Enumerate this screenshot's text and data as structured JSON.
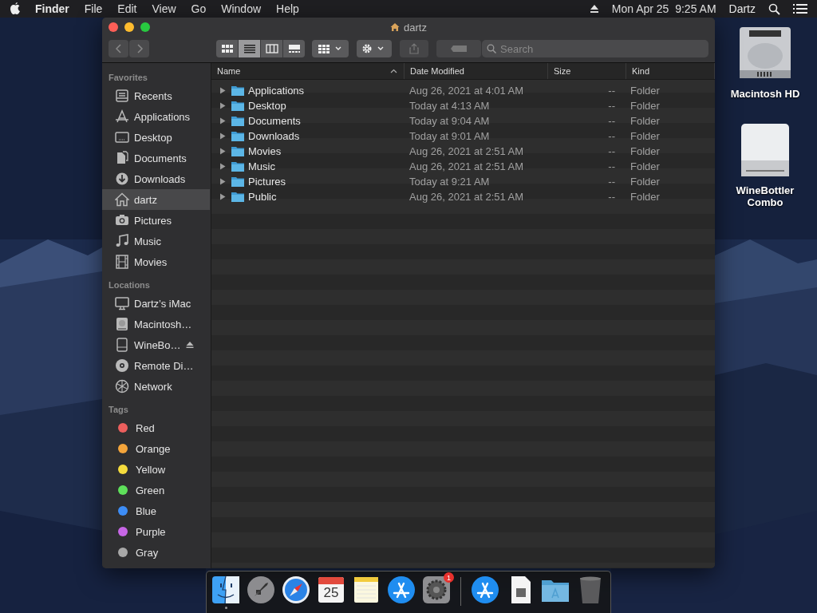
{
  "menu_bar": {
    "items": [
      {
        "label": "Finder",
        "kind": "app"
      },
      {
        "label": "File",
        "kind": "menu"
      },
      {
        "label": "Edit",
        "kind": "menu"
      },
      {
        "label": "View",
        "kind": "menu"
      },
      {
        "label": "Go",
        "kind": "menu"
      },
      {
        "label": "Window",
        "kind": "menu"
      },
      {
        "label": "Help",
        "kind": "menu"
      }
    ],
    "clock": "Mon Apr 25  9:25 AM",
    "user": "Dartz"
  },
  "desktop_icons": [
    {
      "label": "Macintosh HD",
      "kind": "disk"
    },
    {
      "label": "WineBottler Combo",
      "kind": "volume"
    }
  ],
  "window": {
    "title": "dartz",
    "view_modes": [
      {
        "selected": false
      },
      {
        "selected": true
      },
      {
        "selected": false
      },
      {
        "selected": false
      }
    ],
    "search": {
      "placeholder": "Search"
    },
    "sidebar": {
      "sections": [
        {
          "heading": "Favorites",
          "items": [
            {
              "label": "Recents",
              "selected": false
            },
            {
              "label": "Applications",
              "selected": false
            },
            {
              "label": "Desktop",
              "selected": false
            },
            {
              "label": "Documents",
              "selected": false
            },
            {
              "label": "Downloads",
              "selected": false
            },
            {
              "label": "dartz",
              "selected": true
            },
            {
              "label": "Pictures",
              "selected": false
            },
            {
              "label": "Music",
              "selected": false
            },
            {
              "label": "Movies",
              "selected": false
            }
          ]
        },
        {
          "heading": "Locations",
          "items": [
            {
              "label": "Dartz’s iMac",
              "selected": false
            },
            {
              "label": "Macintosh…",
              "selected": false
            },
            {
              "label": "WineBo…",
              "selected": false,
              "ejectable": true
            },
            {
              "label": "Remote Di…",
              "selected": false
            },
            {
              "label": "Network",
              "selected": false
            }
          ]
        },
        {
          "heading": "Tags",
          "items": [
            {
              "label": "Red",
              "selected": false,
              "color": "#ec5f5d"
            },
            {
              "label": "Orange",
              "selected": false,
              "color": "#f4a53b"
            },
            {
              "label": "Yellow",
              "selected": false,
              "color": "#f6dc3d"
            },
            {
              "label": "Green",
              "selected": false,
              "color": "#5ee05a"
            },
            {
              "label": "Blue",
              "selected": false,
              "color": "#3d8df6"
            },
            {
              "label": "Purple",
              "selected": false,
              "color": "#c766e6"
            },
            {
              "label": "Gray",
              "selected": false,
              "color": "#a8a8a8"
            }
          ]
        }
      ]
    },
    "table": {
      "columns": [
        {
          "label": "Name",
          "sorted": true
        },
        {
          "label": "Date Modified",
          "sorted": false
        },
        {
          "label": "Size",
          "sorted": false
        },
        {
          "label": "Kind",
          "sorted": false
        }
      ],
      "rows": [
        {
          "name": "Applications",
          "date": "Aug 26, 2021 at 4:01 AM",
          "size": "--",
          "kind": "Folder",
          "selected": false
        },
        {
          "name": "Desktop",
          "date": "Today at 4:13 AM",
          "size": "--",
          "kind": "Folder",
          "selected": false
        },
        {
          "name": "Documents",
          "date": "Today at 9:04 AM",
          "size": "--",
          "kind": "Folder",
          "selected": false
        },
        {
          "name": "Downloads",
          "date": "Today at 9:01 AM",
          "size": "--",
          "kind": "Folder",
          "selected": false
        },
        {
          "name": "Movies",
          "date": "Aug 26, 2021 at 2:51 AM",
          "size": "--",
          "kind": "Folder",
          "selected": false
        },
        {
          "name": "Music",
          "date": "Aug 26, 2021 at 2:51 AM",
          "size": "--",
          "kind": "Folder",
          "selected": false
        },
        {
          "name": "Pictures",
          "date": "Today at 9:21 AM",
          "size": "--",
          "kind": "Folder",
          "selected": false
        },
        {
          "name": "Public",
          "date": "Aug 26, 2021 at 2:51 AM",
          "size": "--",
          "kind": "Folder",
          "selected": false
        }
      ]
    }
  },
  "dock": {
    "items": [
      {
        "running": true
      },
      {
        "running": false
      },
      {
        "running": false
      },
      {
        "running": false,
        "date": "25"
      },
      {
        "running": false
      },
      {
        "running": false
      },
      {
        "running": false,
        "badge": "1"
      },
      {
        "running": false
      },
      {
        "running": false
      },
      {
        "running": false
      },
      {
        "running": false
      }
    ]
  }
}
